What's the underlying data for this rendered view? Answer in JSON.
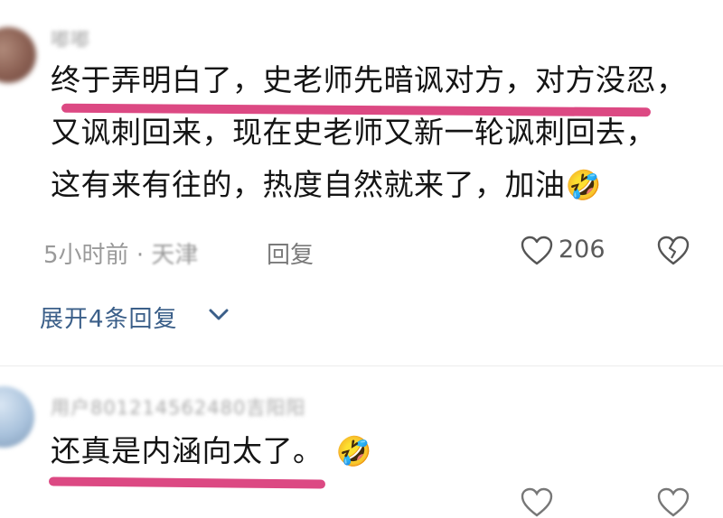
{
  "comments": [
    {
      "username": "嘟嘟",
      "lines": [
        "终于弄明白了，史老师先暗讽对方，对方没忍，",
        "又讽刺回来，现在史老师又新一轮讽刺回去，",
        "这有来有往的，热度自然就来了，加油"
      ],
      "emoji": "🤣",
      "time": "5小时前",
      "location": "天津",
      "reply_label": "回复",
      "like_count": "206",
      "expand_label": "展开4条回复"
    },
    {
      "username": "用户801214562480吉阳阳",
      "text": "还真是内涵向太了。",
      "emoji": "🤣"
    }
  ],
  "colors": {
    "highlight": "#d93a78",
    "link": "#3b5f89",
    "meta": "#9a9a9a"
  },
  "icons": [
    "heart-icon",
    "broken-heart-icon",
    "chevron-down-icon",
    "laughing-emoji-icon"
  ]
}
